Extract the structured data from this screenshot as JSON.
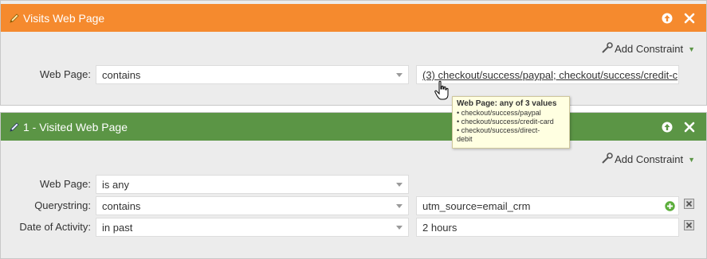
{
  "filters": [
    {
      "title": "Visits Web Page",
      "header_color": "#f58a2e",
      "add_constraint": "Add Constraint",
      "rows": [
        {
          "label": "Web Page:",
          "operator": "contains",
          "value": "(3) checkout/success/paypal; checkout/success/credit-c"
        }
      ]
    },
    {
      "title": "1 - Visited Web Page",
      "header_color": "#5b9545",
      "add_constraint": "Add Constraint",
      "rows": [
        {
          "label": "Web Page:",
          "operator": "is any"
        },
        {
          "label": "Querystring:",
          "operator": "contains",
          "value": "utm_source=email_crm"
        },
        {
          "label": "Date of Activity:",
          "operator": "in past",
          "value": "2 hours"
        }
      ]
    }
  ],
  "tooltip": {
    "title": "Web Page: any of 3 values",
    "items": [
      "• checkout/success/paypal",
      "• checkout/success/credit-card",
      "• checkout/success/direct-",
      "debit"
    ]
  }
}
